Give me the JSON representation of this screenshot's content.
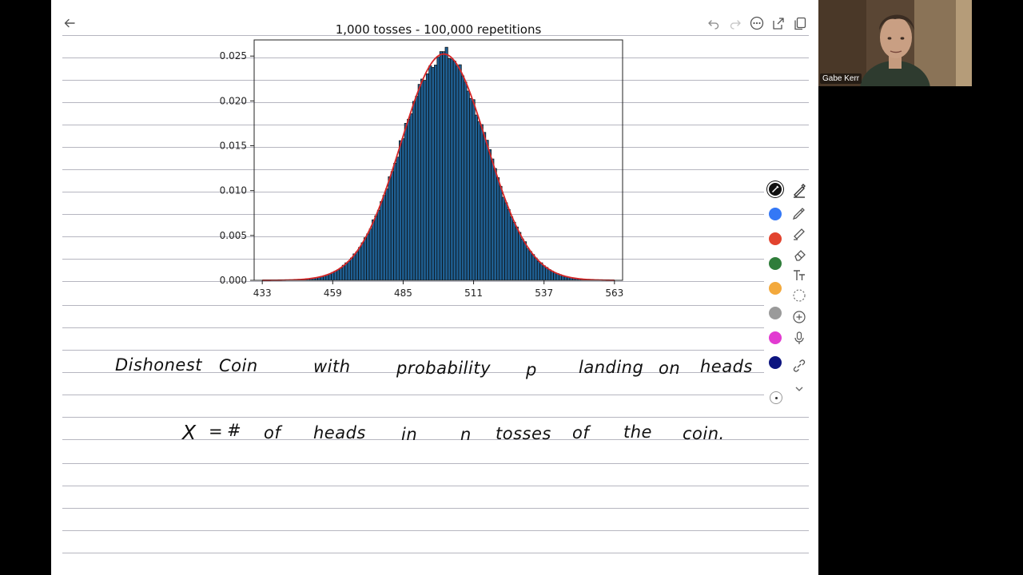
{
  "notes": {
    "line_1_words": [
      "Dishonest",
      "Coin",
      "with",
      "probability",
      "p",
      "landing",
      "on",
      "heads"
    ],
    "line_2_words": [
      "X",
      "=",
      "#",
      "of",
      "heads",
      "in",
      "n",
      "tosses",
      "of",
      "the",
      "coin."
    ]
  },
  "toolbar": {
    "icons": [
      "back-arrow-icon",
      "undo-icon",
      "redo-icon",
      "more-icon",
      "export-icon",
      "duplicate-icon"
    ]
  },
  "pen_palette": {
    "colors": [
      "#111111",
      "#3478f6",
      "#e2432e",
      "#2f7d3a",
      "#f3a93c",
      "#9a9a9a",
      "#e23bd1",
      "#0d1580"
    ],
    "selected_color": "#111111",
    "tools": [
      "pen-icon",
      "pencil-icon",
      "highlighter-icon",
      "eraser-icon",
      "text-icon",
      "lasso-icon",
      "add-icon",
      "microphone-icon",
      "link-icon",
      "chevron-down-icon"
    ]
  },
  "video": {
    "participant_name": "Gabe Kerr"
  },
  "chart_data": {
    "type": "bar",
    "title": "1,000 tosses - 100,000 repetitions",
    "xlabel": "",
    "ylabel": "",
    "xlim": [
      430,
      566
    ],
    "ylim": [
      0,
      0.0268
    ],
    "xticks": [
      433,
      459,
      485,
      511,
      537,
      563
    ],
    "yticks": [
      0.0,
      0.005,
      0.01,
      0.015,
      0.02,
      0.025
    ],
    "ytick_labels": [
      "0.000",
      "0.005",
      "0.010",
      "0.015",
      "0.020",
      "0.025"
    ],
    "bar_color": "#1f5f92",
    "bar_edge_color": "#0b0b0b",
    "curve_color": "#d62728",
    "histogram": {
      "bin_width": 1,
      "bins_start": 433,
      "bins_end": 563,
      "mean": 500,
      "std": 15.81,
      "note": "Histogram of heads count; bars follow the normal density curve"
    },
    "series": [
      {
        "name": "",
        "kind": "histogram"
      },
      {
        "name": "",
        "kind": "line"
      }
    ]
  }
}
